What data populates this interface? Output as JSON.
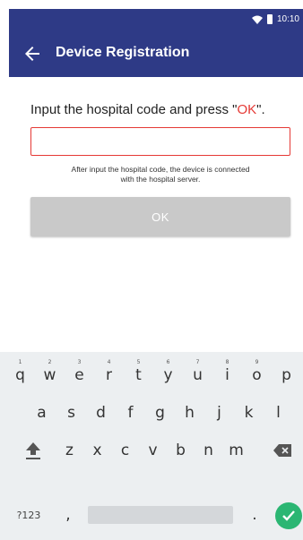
{
  "status_bar": {
    "time": "10:10"
  },
  "app_bar": {
    "title": "Device Registration"
  },
  "content": {
    "prompt_prefix": "Input the hospital code and press \"",
    "prompt_ok": "OK",
    "prompt_suffix": "\".",
    "input_value": "",
    "helper_line1": "After input the hospital code, the device is connected",
    "helper_line2": "with the hospital server.",
    "ok_button_label": "OK"
  },
  "keyboard": {
    "row1": [
      {
        "key": "q",
        "hint": "1"
      },
      {
        "key": "w",
        "hint": "2"
      },
      {
        "key": "e",
        "hint": "3"
      },
      {
        "key": "r",
        "hint": "4"
      },
      {
        "key": "t",
        "hint": "5"
      },
      {
        "key": "y",
        "hint": "6"
      },
      {
        "key": "u",
        "hint": "7"
      },
      {
        "key": "i",
        "hint": "8"
      },
      {
        "key": "o",
        "hint": "9"
      },
      {
        "key": "p",
        "hint": ""
      }
    ],
    "row2": [
      "a",
      "s",
      "d",
      "f",
      "g",
      "h",
      "j",
      "k",
      "l"
    ],
    "row3": [
      "z",
      "x",
      "c",
      "v",
      "b",
      "n",
      "m"
    ],
    "symbols_label": "?123",
    "comma": ",",
    "period": "."
  },
  "colors": {
    "primary": "#2e3a86",
    "accent_red": "#e53935",
    "enter_green": "#2bb673",
    "button_disabled": "#c9c9c9"
  },
  "icons": [
    "wifi-icon",
    "battery-icon",
    "back-arrow-icon",
    "shift-icon",
    "backspace-icon",
    "check-icon"
  ]
}
